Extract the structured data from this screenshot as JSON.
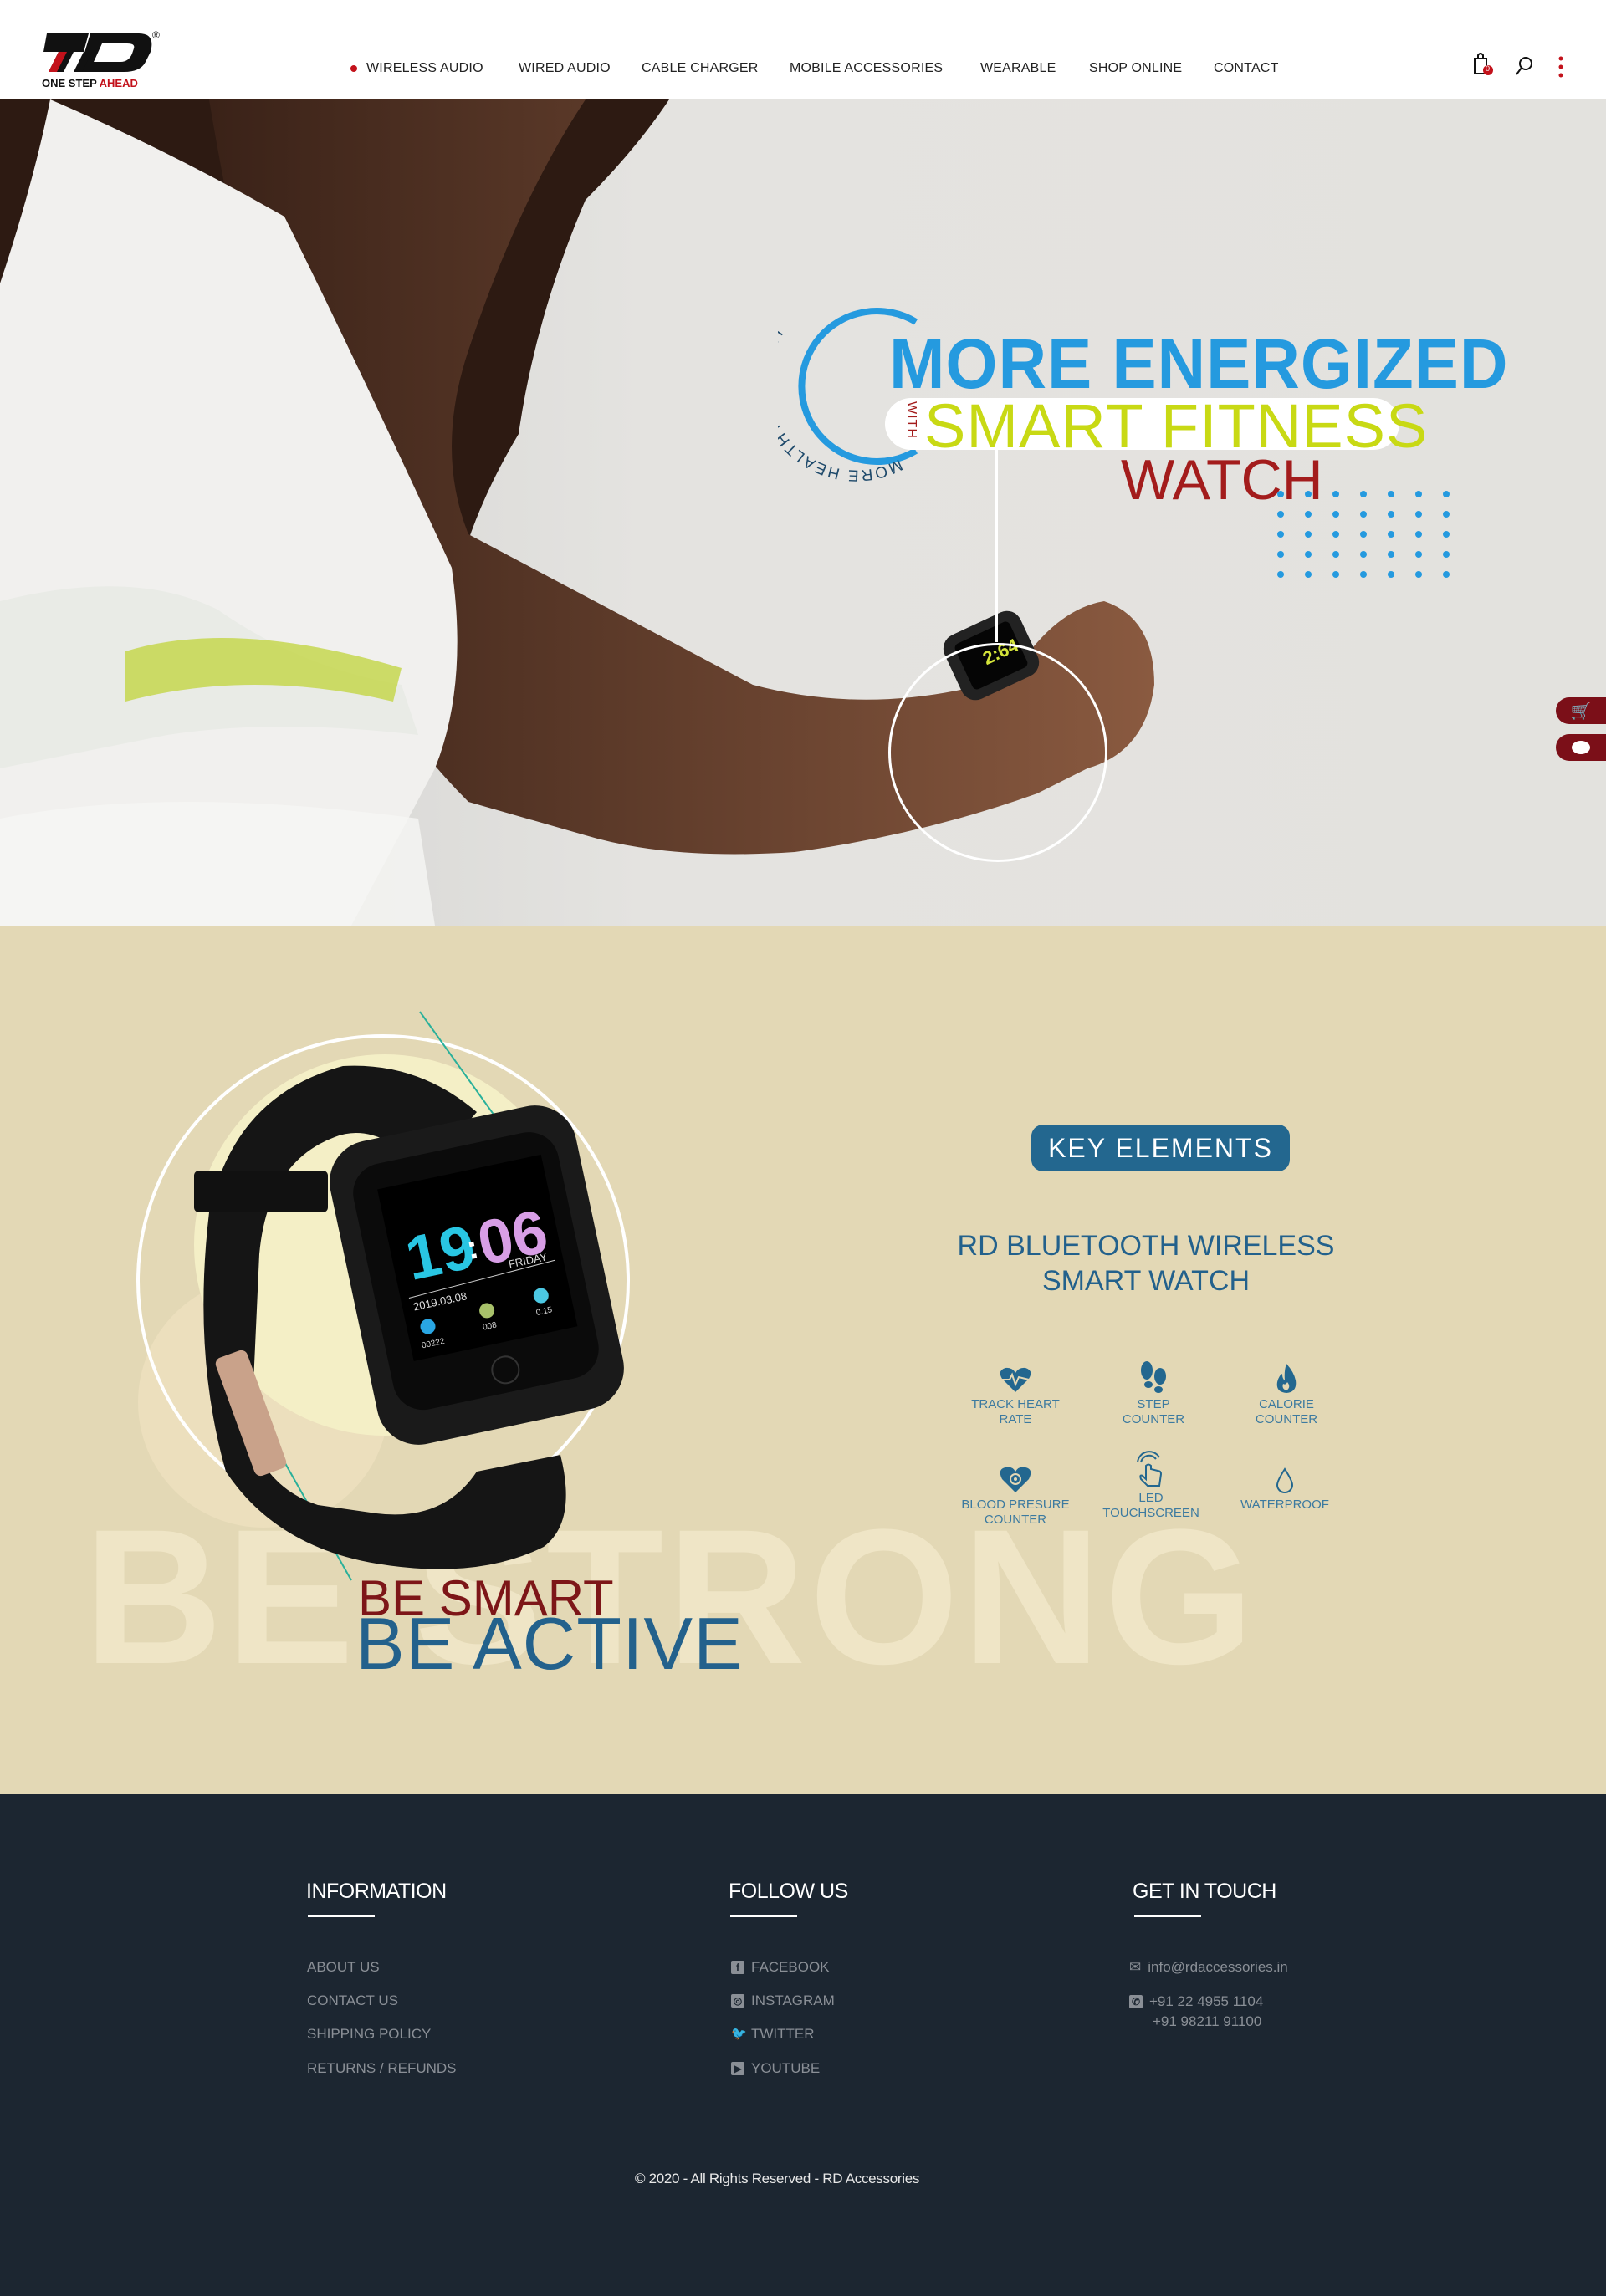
{
  "brand": {
    "logo_text": "RD",
    "tagline_1": "ONE STEP",
    "tagline_2": "AHEAD",
    "registered": "®"
  },
  "nav": {
    "items": [
      "WIRELESS AUDIO",
      "WIRED AUDIO",
      "CABLE CHARGER",
      "MOBILE ACCESSORIES",
      "WEARABLE",
      "SHOP ONLINE",
      "CONTACT"
    ],
    "active": 0
  },
  "header_icons": {
    "cart_count": "0",
    "cart": "shopping-bag-icon",
    "search": "search-icon",
    "menu": "more-vertical-icon"
  },
  "hero": {
    "arc_text": "MORE HEALTHY MORE FIT",
    "line1": "MORE ENERGIZED",
    "with": "WITH",
    "line2": "SMART FITNESS",
    "line3": "WATCH",
    "watch_screen": "2:64"
  },
  "side_buttons": {
    "cart": "cart-icon",
    "chat": "chat-icon"
  },
  "feature": {
    "watermark": "BE STRONG",
    "be_smart": "BE SMART",
    "be_active": "BE ACTIVE",
    "watch": {
      "hours": "19",
      "minutes": "06",
      "date": "2019.03.08",
      "day": "FRIDAY",
      "steps": "00222",
      "cal": "008",
      "dist": "0.15"
    },
    "badge": "KEY ELEMENTS",
    "title_1": "RD BLUETOOTH WIRELESS",
    "title_2": "SMART WATCH",
    "items": [
      {
        "l1": "TRACK HEART",
        "l2": "RATE",
        "icon": "heart-rate-icon"
      },
      {
        "l1": "STEP",
        "l2": "COUNTER",
        "icon": "footsteps-icon"
      },
      {
        "l1": "CALORIE",
        "l2": "COUNTER",
        "icon": "flame-icon"
      },
      {
        "l1": "BLOOD PRESURE",
        "l2": "COUNTER",
        "icon": "blood-pressure-icon"
      },
      {
        "l1": "LED",
        "l2": "TOUCHSCREEN",
        "icon": "touch-icon"
      },
      {
        "l1": "WATERPROOF",
        "l2": "",
        "icon": "water-drop-icon"
      }
    ],
    "colors": {
      "accent": "#23618c",
      "bg": "#e3d8b5"
    }
  },
  "footer": {
    "info": {
      "heading": "INFORMATION",
      "links": [
        "ABOUT US",
        "CONTACT US",
        "SHIPPING POLICY",
        "RETURNS / REFUNDS"
      ]
    },
    "follow": {
      "heading": "FOLLOW US",
      "links": [
        "FACEBOOK",
        "INSTAGRAM",
        "TWITTER",
        "YOUTUBE"
      ]
    },
    "contact": {
      "heading": "GET IN TOUCH",
      "email": "info@rdaccessories.in",
      "phone1": "+91 22 4955 1104",
      "phone2": "+91 98211 91100"
    },
    "copyright": "© 2020 - All Rights Reserved - RD Accessories"
  }
}
